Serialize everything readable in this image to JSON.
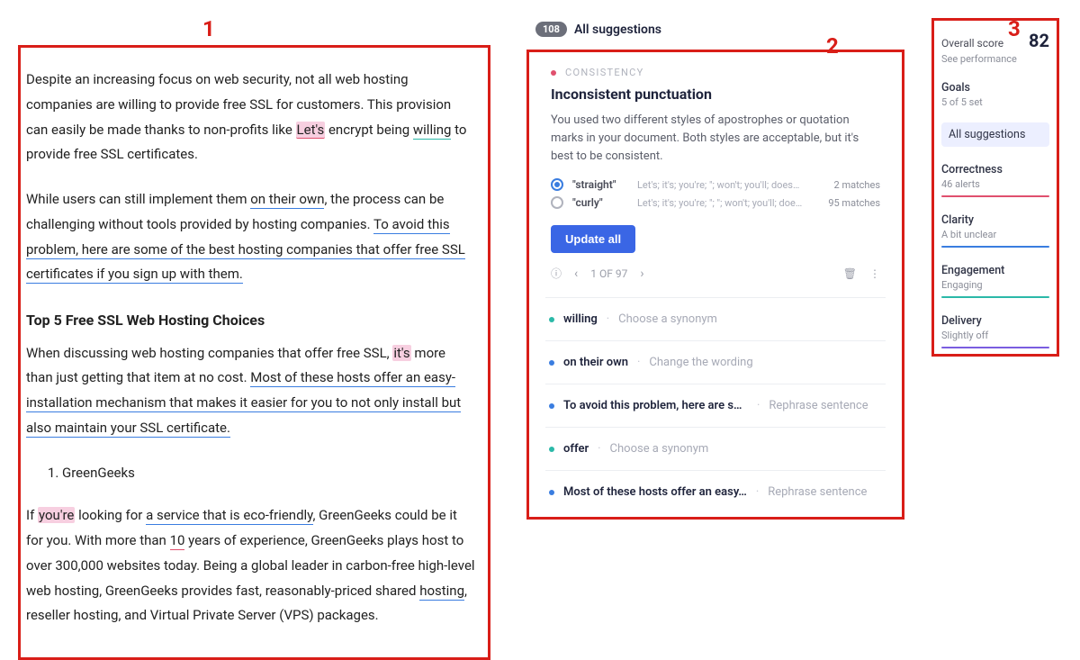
{
  "annotations": {
    "one": "1",
    "two": "2",
    "three": "3"
  },
  "editor": {
    "p1a": "Despite an increasing focus on web security, not all web hosting companies are willing to provide free SSL for customers. This provision can easily be made thanks to non-profits like ",
    "p1_hl": "Let's",
    "p1b": " encrypt being ",
    "p1_ul": "willing",
    "p1c": " to provide free SSL certificates.",
    "p2a": "While users can still implement them ",
    "p2_u1": "on their own",
    "p2b": ", the process can be challenging without tools provided by hosting companies. ",
    "p2_u2": "To avoid this problem, here are some of the best hosting companies that offer free SSL certificates if you sign up with them.",
    "h1": "Top 5 Free SSL Web Hosting Choices",
    "p3a": "When discussing web hosting companies that offer free SSL, ",
    "p3_hl": "it's",
    "p3b": " more than just getting that item at no cost. ",
    "p3_u": "Most of these hosts offer an easy-installation mechanism that makes it easier for you to not only install but also maintain your SSL certificate.",
    "li1": "GreenGeeks",
    "p4a": "If ",
    "p4_hl": "you're",
    "p4b": " looking for ",
    "p4_u1": "a service that is eco-friendly",
    "p4c": ", GreenGeeks could be it for you. With more than ",
    "p4_u2": "10",
    "p4d": " years of experience, GreenGeeks plays host to over 300,000 websites today. Being a global leader in carbon-free high-level web hosting, GreenGeeks provides fast, reasonably-priced shared ",
    "p4_u3": "hosting",
    "p4e": ", reseller hosting, and Virtual Private Server (VPS) packages."
  },
  "suggestions": {
    "count_badge": "108",
    "header": "All suggestions",
    "card": {
      "category": "CONSISTENCY",
      "title": "Inconsistent punctuation",
      "desc": "You used two different styles of apostrophes or quotation marks in your document. Both styles are acceptable, but it's best to be consistent.",
      "options": [
        {
          "name": "\"straight\"",
          "preview": "Let's; it's; you're; \"; won't; you'll; does…",
          "matches": "2 matches",
          "selected": true
        },
        {
          "name": "\"curly\"",
          "preview": "Let's; it's; you're; \"; \"; won't; you'll; doe…",
          "matches": "95 matches",
          "selected": false
        }
      ],
      "button": "Update all",
      "pager": "1 OF 97"
    },
    "list": [
      {
        "dot": "teal",
        "text": "willing",
        "action": "Choose a synonym"
      },
      {
        "dot": "blue",
        "text": "on their own",
        "action": "Change the wording"
      },
      {
        "dot": "blue",
        "text": "To avoid this problem, here are so…",
        "action": "Rephrase sentence"
      },
      {
        "dot": "teal",
        "text": "offer",
        "action": "Choose a synonym"
      },
      {
        "dot": "blue",
        "text": "Most of these hosts offer an easy…",
        "action": "Rephrase sentence"
      }
    ]
  },
  "sidebar": {
    "score_label": "Overall score",
    "score_value": "82",
    "score_sub": "See performance",
    "goals_label": "Goals",
    "goals_sub": "5 of 5 set",
    "all": "All suggestions",
    "metrics": [
      {
        "title": "Correctness",
        "sub": "46 alerts",
        "color": "red"
      },
      {
        "title": "Clarity",
        "sub": "A bit unclear",
        "color": "blue"
      },
      {
        "title": "Engagement",
        "sub": "Engaging",
        "color": "teal"
      },
      {
        "title": "Delivery",
        "sub": "Slightly off",
        "color": "purple"
      }
    ]
  }
}
